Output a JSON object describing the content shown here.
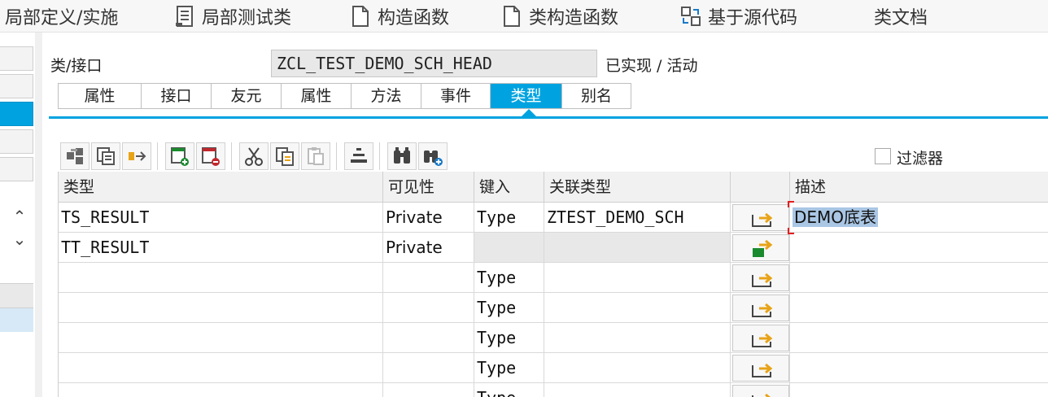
{
  "toolbar": {
    "items": [
      {
        "label": "局部定义/实施"
      },
      {
        "label": "局部测试类"
      },
      {
        "label": "构造函数"
      },
      {
        "label": "类构造函数"
      },
      {
        "label": "基于源代码"
      },
      {
        "label": "类文档"
      }
    ]
  },
  "header": {
    "class_label": "类/接口",
    "class_value": "ZCL_TEST_DEMO_SCH_HEAD",
    "status": "已实现 / 活动"
  },
  "tabs": [
    {
      "label": "属性"
    },
    {
      "label": "接口"
    },
    {
      "label": "友元"
    },
    {
      "label": "属性"
    },
    {
      "label": "方法"
    },
    {
      "label": "事件"
    },
    {
      "label": "类型"
    },
    {
      "label": "别名"
    }
  ],
  "active_tab": "类型",
  "filter": {
    "label": "过滤器",
    "checked": false
  },
  "grid": {
    "columns": [
      "类型",
      "可见性",
      "键入",
      "关联类型",
      "",
      "描述"
    ],
    "rows": [
      {
        "type": "TS_RESULT",
        "visibility": "Private",
        "typing": "Type",
        "assoc": "ZTEST_DEMO_SCH",
        "desc": "DEMO底表"
      },
      {
        "type": "TT_RESULT",
        "visibility": "Private",
        "typing": "",
        "assoc": "",
        "desc": ""
      },
      {
        "type": "",
        "visibility": "",
        "typing": "Type",
        "assoc": "",
        "desc": ""
      },
      {
        "type": "",
        "visibility": "",
        "typing": "Type",
        "assoc": "",
        "desc": ""
      },
      {
        "type": "",
        "visibility": "",
        "typing": "Type",
        "assoc": "",
        "desc": ""
      },
      {
        "type": "",
        "visibility": "",
        "typing": "Type",
        "assoc": "",
        "desc": ""
      },
      {
        "type": "",
        "visibility": "",
        "typing": "Type",
        "assoc": "",
        "desc": ""
      }
    ]
  },
  "colors": {
    "accent": "#00a3e0",
    "header_bg": "#f1f1f1",
    "selection": "#a9c6e4",
    "green_icon": "#1a8a2e",
    "orange_arrow": "#e8a317"
  }
}
